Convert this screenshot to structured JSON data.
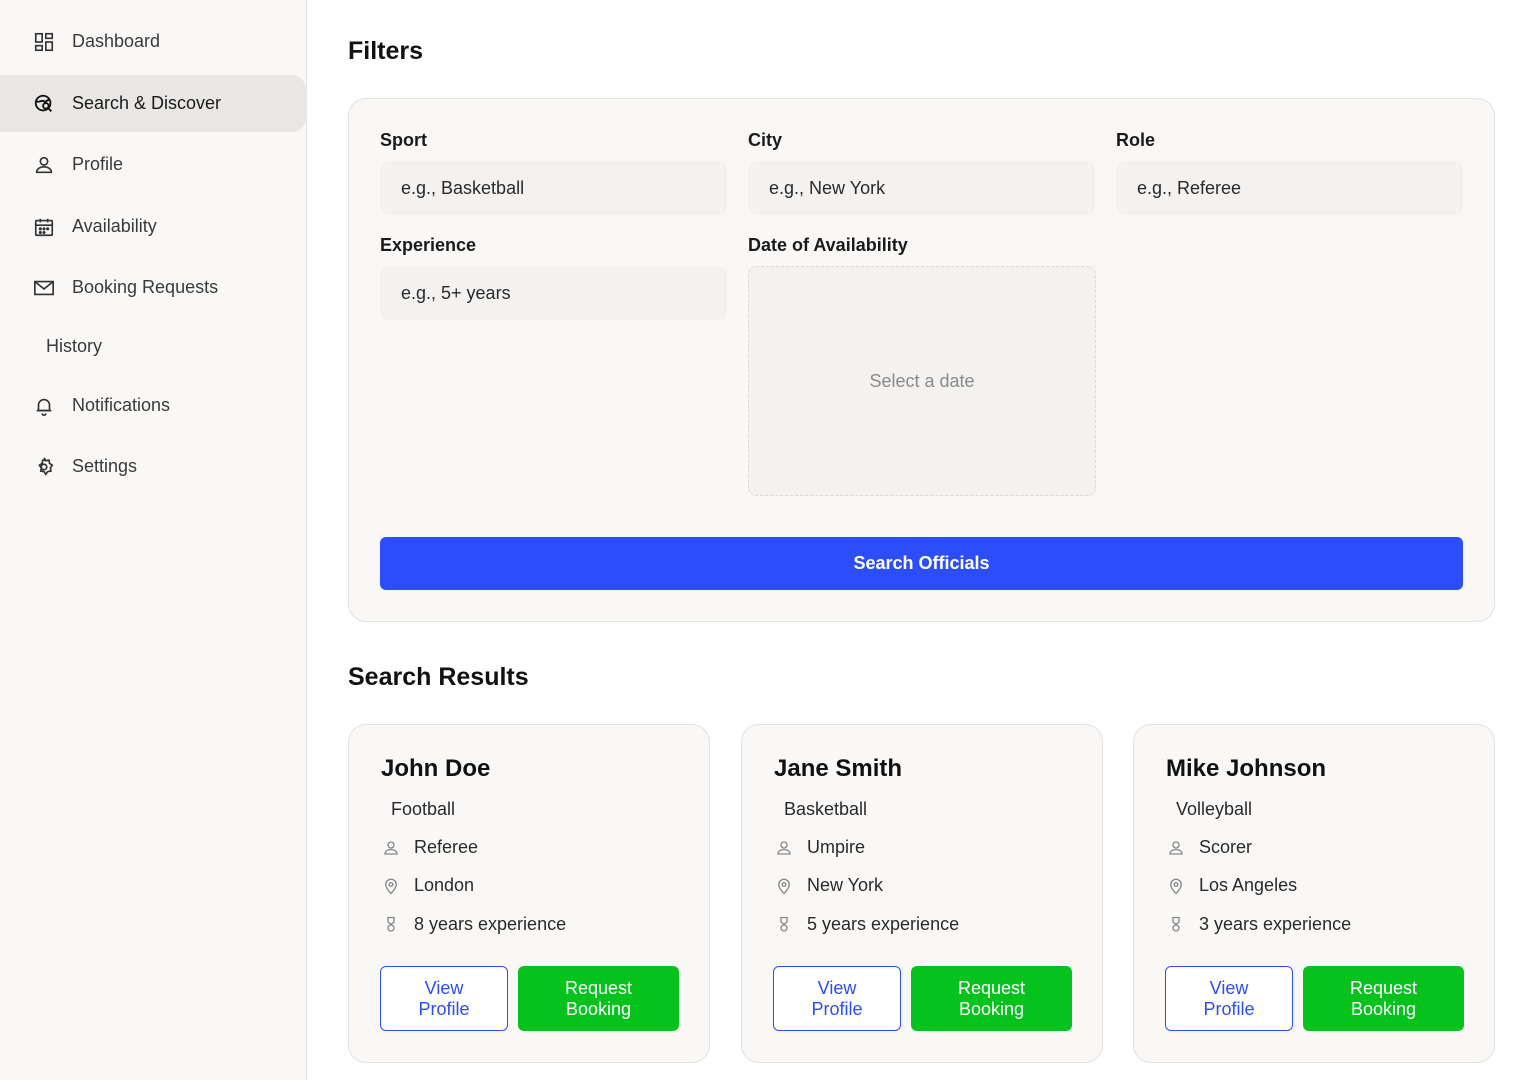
{
  "sidebar": {
    "items": [
      {
        "label": "Dashboard",
        "icon": "dashboard-icon",
        "active": false
      },
      {
        "label": "Search & Discover",
        "icon": "search-globe-icon",
        "active": true
      },
      {
        "label": "Profile",
        "icon": "user-icon",
        "active": false
      },
      {
        "label": "Availability",
        "icon": "calendar-icon",
        "active": false
      },
      {
        "label": "Booking Requests",
        "icon": "mail-icon",
        "active": false
      },
      {
        "label": "History",
        "icon": "",
        "active": false
      },
      {
        "label": "Notifications",
        "icon": "bell-icon",
        "active": false
      },
      {
        "label": "Settings",
        "icon": "gear-icon",
        "active": false
      }
    ]
  },
  "filters": {
    "title": "Filters",
    "sport": {
      "label": "Sport",
      "placeholder": "e.g., Basketball"
    },
    "city": {
      "label": "City",
      "placeholder": "e.g., New York"
    },
    "role": {
      "label": "Role",
      "placeholder": "e.g., Referee"
    },
    "experience": {
      "label": "Experience",
      "placeholder": "e.g., 5+ years"
    },
    "date": {
      "label": "Date of Availability",
      "placeholder": "Select a date"
    },
    "search_button": "Search Officials"
  },
  "results": {
    "title": "Search Results",
    "cards": [
      {
        "name": "John Doe",
        "sport": "Football",
        "role": "Referee",
        "city": "London",
        "experience": "8 years experience",
        "view_label": "View Profile",
        "book_label": "Request Booking"
      },
      {
        "name": "Jane Smith",
        "sport": "Basketball",
        "role": "Umpire",
        "city": "New York",
        "experience": "5 years experience",
        "view_label": "View Profile",
        "book_label": "Request Booking"
      },
      {
        "name": "Mike Johnson",
        "sport": "Volleyball",
        "role": "Scorer",
        "city": "Los Angeles",
        "experience": "3 years experience",
        "view_label": "View Profile",
        "book_label": "Request Booking"
      }
    ]
  },
  "colors": {
    "primary": "#2b4dfa",
    "success": "#05c31c",
    "sidebar_bg": "#f9f8f7",
    "active_bg": "#e9e7e5"
  }
}
